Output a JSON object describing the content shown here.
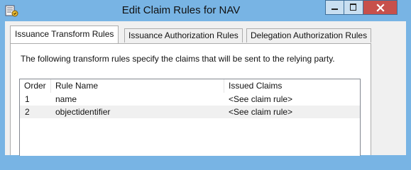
{
  "window": {
    "title": "Edit Claim Rules for NAV",
    "icon": "claim-rules-app-icon"
  },
  "tabs": [
    {
      "label": "Issuance Transform Rules",
      "active": true
    },
    {
      "label": "Issuance Authorization Rules",
      "active": false
    },
    {
      "label": "Delegation Authorization Rules",
      "active": false
    }
  ],
  "panel": {
    "description": "The following transform rules specify the claims that will be sent to the relying party."
  },
  "rules_table": {
    "columns": [
      "Order",
      "Rule Name",
      "Issued Claims"
    ],
    "rows": [
      {
        "order": "1",
        "name": "name",
        "issued": "<See claim rule>"
      },
      {
        "order": "2",
        "name": "objectidentifier",
        "issued": "<See claim rule>"
      }
    ]
  },
  "colors": {
    "titlebar": "#78b4e4",
    "close_button": "#c7504b",
    "dialog_bg": "#f0f0f0"
  }
}
